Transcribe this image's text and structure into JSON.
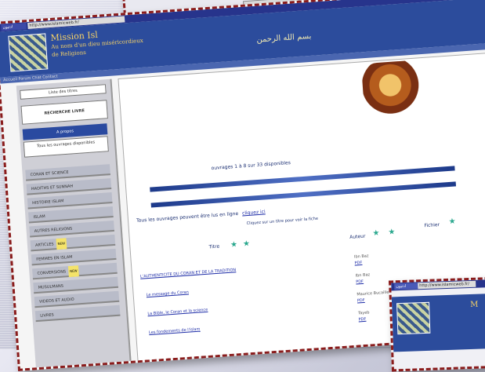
{
  "top_thumbnail": {
    "menu_items": [
      "",
      "",
      ""
    ],
    "label": ""
  },
  "window": {
    "titlebar_tab": "ادتيون",
    "address": "http://www.islamicweb.fr/"
  },
  "banner": {
    "title": "Mission Isl",
    "subtitle": "Au nom d'un dieu miséricordieux",
    "tagline": "de Religions",
    "arabic_text": "بسم الله الرحمن",
    "nav_strip": "Accueil  Forum  Chat  Contact"
  },
  "sidebar": {
    "box_top": "Liste des titres",
    "box_mid": "RECHERCHE LIVRE",
    "blue_item": "A propos",
    "white_item": "Tous les ouvrages disponibles",
    "items": [
      {
        "label": "CORAN ET SCIENCE",
        "new": false
      },
      {
        "label": "HADITHS ET SUNNAH",
        "new": false
      },
      {
        "label": "HISTOIRE ISLAM",
        "new": false
      },
      {
        "label": "ISLAM",
        "new": false
      },
      {
        "label": "AUTRES RELIGIONS",
        "new": false
      },
      {
        "label": "ARTICLES",
        "new": true
      },
      {
        "label": "FEMMES EN ISLAM",
        "new": false
      },
      {
        "label": "CONVERSIONS",
        "new": true
      },
      {
        "label": "MUSULMANS",
        "new": false
      },
      {
        "label": "VIDEOS ET AUDIO",
        "new": false
      },
      {
        "label": "LIVRES",
        "new": false
      }
    ],
    "new_badge": "NEW"
  },
  "content": {
    "count_text": "ouvrages 1 à 8 sur 33 disponibles",
    "note": "Tous les ouvrages peuvent être lus en ligne",
    "note_link": "cliquez ici",
    "note2": "Cliquez sur un titre pour voir la fiche",
    "headers": {
      "left": "Titre",
      "mid": "Auteur",
      "right": "Fichier"
    },
    "rows": [
      {
        "title": "L'AUTHENTICITE DU CORAN ET DE LA TRADITION",
        "author": "Ibn Baz",
        "file": "PDF"
      },
      {
        "title": "Le message du Coran",
        "author": "Ibn Baz",
        "file": "PDF"
      },
      {
        "title": "La Bible, le Coran et la science",
        "author": "Maurice Bucaille",
        "file": "PDF"
      },
      {
        "title": "Les fondements de l'islam",
        "author": "Tayeb",
        "file": "PDF"
      }
    ]
  },
  "bottom_thumbnail": {
    "titlebar_tab": "ادتيون",
    "address": "http://www.islamicweb.fr/",
    "banner_title": "M"
  }
}
